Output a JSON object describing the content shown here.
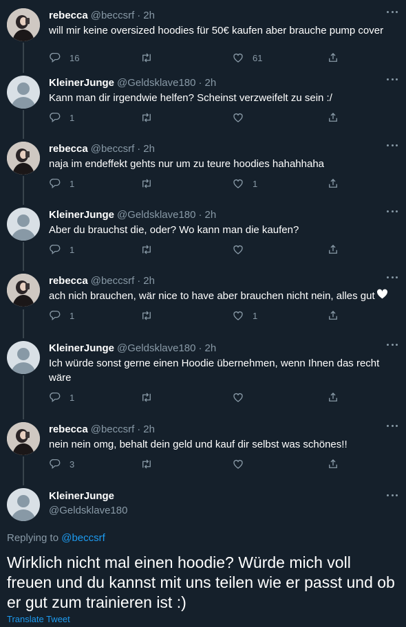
{
  "tweets": [
    {
      "name": "rebecca",
      "handle": "@beccsrf",
      "time": "2h",
      "text": "will mir keine oversized hoodies für 50€ kaufen aber brauche pump cover",
      "replies": "16",
      "retweets": "",
      "likes": "61",
      "avatar": "photo"
    },
    {
      "name": "KleinerJunge",
      "handle": "@Geldsklave180",
      "time": "2h",
      "text": "Kann man dir irgendwie helfen? Scheinst verzweifelt zu sein :/",
      "replies": "1",
      "retweets": "",
      "likes": "",
      "avatar": "default"
    },
    {
      "name": "rebecca",
      "handle": "@beccsrf",
      "time": "2h",
      "text": "naja im endeffekt gehts nur um zu teure hoodies hahahhaha",
      "replies": "1",
      "retweets": "",
      "likes": "1",
      "avatar": "photo"
    },
    {
      "name": "KleinerJunge",
      "handle": "@Geldsklave180",
      "time": "2h",
      "text": "Aber du brauchst die, oder? Wo kann man die kaufen?",
      "replies": "1",
      "retweets": "",
      "likes": "",
      "avatar": "default"
    },
    {
      "name": "rebecca",
      "handle": "@beccsrf",
      "time": "2h",
      "text": "ach nich brauchen, wär nice to have aber brauchen nicht nein, alles gut",
      "replies": "1",
      "retweets": "",
      "likes": "1",
      "avatar": "photo"
    },
    {
      "name": "KleinerJunge",
      "handle": "@Geldsklave180",
      "time": "2h",
      "text": "Ich würde sonst gerne einen Hoodie übernehmen, wenn Ihnen das recht wäre",
      "replies": "1",
      "retweets": "",
      "likes": "",
      "avatar": "default"
    },
    {
      "name": "rebecca",
      "handle": "@beccsrf",
      "time": "2h",
      "text": "nein nein omg, behalt dein geld und kauf dir selbst was schönes!!",
      "replies": "3",
      "retweets": "",
      "likes": "",
      "avatar": "photo"
    }
  ],
  "main": {
    "name": "KleinerJunge",
    "handle": "@Geldsklave180",
    "replying_label": "Replying to",
    "replying_handle": "@beccsrf",
    "text": "Wirklich nicht mal einen hoodie? Würde mich voll freuen und du kannst mit uns teilen wie er passt und ob er gut zum trainieren ist :)",
    "translate": "Translate Tweet"
  },
  "icons": [
    "more-icon",
    "reply-icon",
    "retweet-icon",
    "like-icon",
    "share-icon",
    "white-heart-emoji"
  ],
  "colors": {
    "background": "#15202b",
    "muted": "#8899a6",
    "link": "#1d9bf0",
    "text": "#ffffff"
  }
}
